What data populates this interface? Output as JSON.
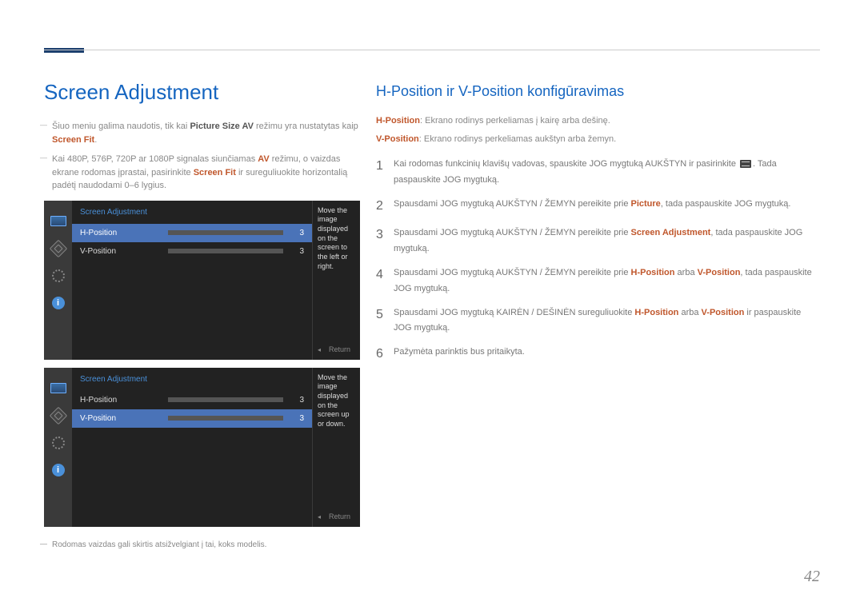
{
  "header": {
    "title": "Screen Adjustment"
  },
  "left": {
    "note1_pre": "Šiuo meniu galima naudotis, tik kai ",
    "note1_b1": "Picture Size AV",
    "note1_mid": " režimu yra nustatytas kaip ",
    "note1_b2": "Screen Fit",
    "note1_post": ".",
    "note2_pre": "Kai 480P, 576P, 720P ar 1080P signalas siunčiamas ",
    "note2_b1": "AV",
    "note2_mid": " režimu, o vaizdas ekrane rodomas įprastai, pasirinkite ",
    "note2_b2": "Screen Fit",
    "note2_post": " ir sureguliuokite horizontalią padėtį naudodami 0–6 lygius.",
    "osd1": {
      "title": "Screen Adjustment",
      "row1": {
        "label": "H-Position",
        "value": "3"
      },
      "row2": {
        "label": "V-Position",
        "value": "3"
      },
      "tip": "Move the image displayed on the screen to the left or right.",
      "return": "Return"
    },
    "osd2": {
      "title": "Screen Adjustment",
      "row1": {
        "label": "H-Position",
        "value": "3"
      },
      "row2": {
        "label": "V-Position",
        "value": "3"
      },
      "tip": "Move the image displayed on the screen up or down.",
      "return": "Return"
    },
    "footnote": "Rodomas vaizdas gali skirtis atsižvelgiant į tai, koks modelis."
  },
  "right": {
    "title": "H-Position ir V-Position konfigūravimas",
    "desc1_b": "H-Position",
    "desc1": ": Ekrano rodinys perkeliamas į kairę arba dešinę.",
    "desc2_b": "V-Position",
    "desc2": ": Ekrano rodinys perkeliamas aukštyn arba žemyn.",
    "step1_a": "Kai rodomas funkcinių klavišų vadovas, spauskite JOG mygtuką AUKŠTYN ir pasirinkite ",
    "step1_b": ". Tada paspauskite JOG mygtuką.",
    "step2_a": "Spausdami JOG mygtuką AUKŠTYN / ŽEMYN pereikite prie ",
    "step2_b1": "Picture",
    "step2_c": ", tada paspauskite JOG mygtuką.",
    "step3_a": "Spausdami JOG mygtuką AUKŠTYN / ŽEMYN pereikite prie ",
    "step3_b1": "Screen Adjustment",
    "step3_c": ", tada paspauskite JOG mygtuką.",
    "step4_a": "Spausdami JOG mygtuką AUKŠTYN / ŽEMYN pereikite prie ",
    "step4_b1": "H-Position",
    "step4_mid": " arba ",
    "step4_b2": "V-Position",
    "step4_c": ", tada paspauskite JOG mygtuką.",
    "step5_a": "Spausdami JOG mygtuką KAIRĖN / DEŠINĖN sureguliuokite ",
    "step5_b1": "H-Position",
    "step5_mid": " arba ",
    "step5_b2": "V-Position",
    "step5_c": " ir paspauskite JOG mygtuką.",
    "step6": "Pažymėta parinktis bus pritaikyta.",
    "nums": {
      "n1": "1",
      "n2": "2",
      "n3": "3",
      "n4": "4",
      "n5": "5",
      "n6": "6"
    }
  },
  "page": "42"
}
